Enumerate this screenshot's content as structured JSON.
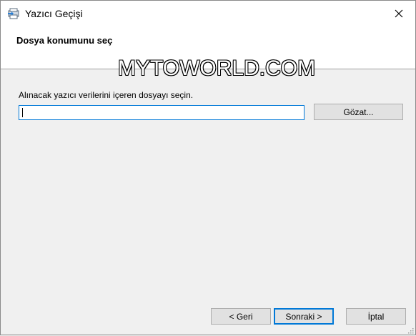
{
  "window": {
    "title": "Yazıcı Geçişi"
  },
  "header": {
    "title": "Dosya konumunu seç"
  },
  "watermark": "MYTOWORLD.COM",
  "main": {
    "prompt_label": "Alınacak yazıcı verilerini içeren dosyayı seçin.",
    "file_path_value": "",
    "browse_label": "Gözat..."
  },
  "footer": {
    "back_label": "< Geri",
    "next_label": "Sonraki >",
    "cancel_label": "İptal"
  },
  "icons": {
    "app": "printer-migration-icon",
    "close": "close-icon"
  },
  "colors": {
    "accent": "#0078d7",
    "panel": "#ffffff",
    "background": "#f0f0f0"
  }
}
